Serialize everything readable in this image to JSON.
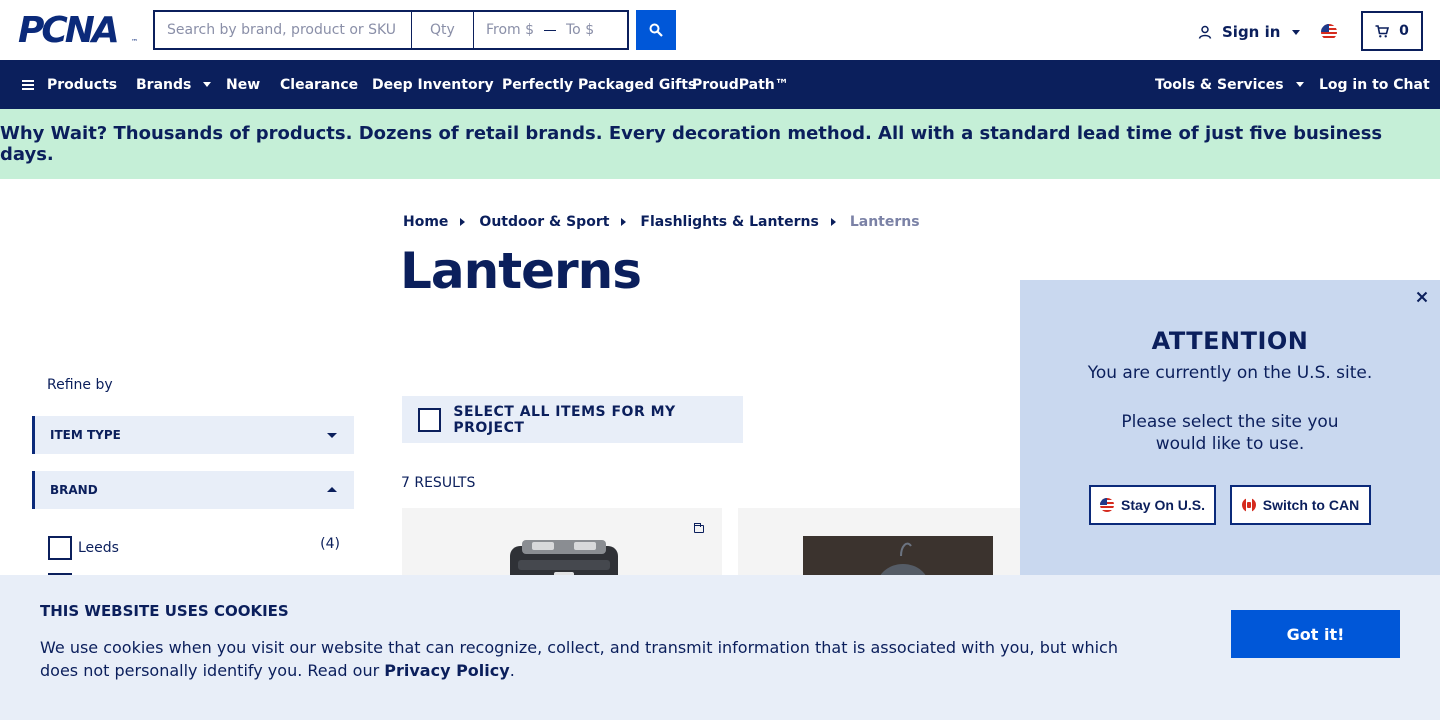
{
  "header": {
    "logo": "PCNA",
    "search_placeholder": "Search by brand, product or SKU",
    "qty_placeholder": "Qty",
    "price_from_placeholder": "From $",
    "price_to_placeholder": "To $",
    "sign_in_label": "Sign in",
    "cart_count": "0"
  },
  "nav": {
    "products": "Products",
    "brands": "Brands",
    "new": "New",
    "clearance": "Clearance",
    "deep_inventory": "Deep Inventory",
    "gifts": "Perfectly Packaged Gifts",
    "proudpath": "ProudPath™",
    "tools": "Tools & Services",
    "chat": "Log in to Chat"
  },
  "promo": {
    "text": "Why Wait? Thousands of products. Dozens of retail brands. Every decoration method. All with a standard lead time of just five business days."
  },
  "breadcrumb": {
    "home": "Home",
    "level1": "Outdoor & Sport",
    "level2": "Flashlights & Lanterns",
    "current": "Lanterns"
  },
  "page": {
    "title": "Lanterns",
    "select_all_label": "SELECT ALL ITEMS FOR MY PROJECT",
    "results_label": "7 RESULTS"
  },
  "sidebar": {
    "refine_label": "Refine by",
    "facet_item_type": "ITEM TYPE",
    "facet_brand": "BRAND",
    "brands": [
      {
        "name": "Leeds",
        "count": "(4)"
      }
    ]
  },
  "country_modal": {
    "title": "ATTENTION",
    "line1": "You are currently on the U.S. site.",
    "line2": "Please select the site you",
    "line3": "would like to use.",
    "stay_label": "Stay On U.S.",
    "switch_label": "Switch to CAN"
  },
  "cookie": {
    "title": "THIS WEBSITE USES COOKIES",
    "text": "We use cookies when you visit our website that can recognize, collect, and transmit information that is associated with you, but which does not personally identify you. Read our",
    "link": "Privacy Policy",
    "period": ".",
    "button": "Got it!"
  },
  "colors": {
    "navy": "#0b1f5c",
    "accent_blue": "#0057d8",
    "promo_green": "#c5efd7",
    "modal_blue": "#c9d8ef",
    "panel_gray": "#e8eef8"
  }
}
